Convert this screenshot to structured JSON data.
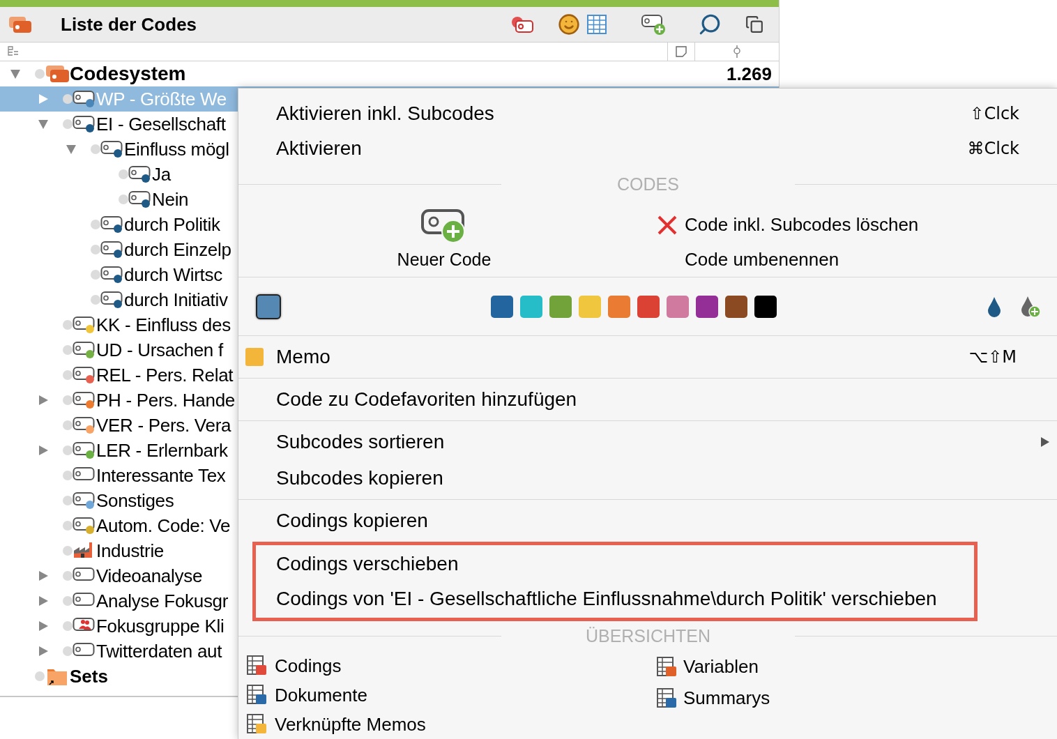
{
  "window": {
    "title": "Liste der Codes"
  },
  "tree": {
    "root": {
      "label": "Codesystem",
      "count": "1.269",
      "expanded": true
    },
    "items": [
      {
        "label": "WP - Größte We",
        "kind": "code",
        "color": "#4a86b8",
        "selected": true,
        "expanded": false
      },
      {
        "label": "EI - Gesellschaft",
        "kind": "code",
        "color": "#1f5a86",
        "selected": false,
        "expanded": true,
        "children": [
          {
            "label": "Einfluss mögl",
            "kind": "code",
            "color": "#1f5a86",
            "selected": false,
            "expanded": true,
            "children": [
              {
                "label": "Ja",
                "kind": "code",
                "color": "#1f5a86",
                "selected": false
              },
              {
                "label": "Nein",
                "kind": "code",
                "color": "#1f5a86",
                "selected": false
              }
            ]
          },
          {
            "label": "durch Politik",
            "kind": "code",
            "color": "#1f5a86",
            "selected": false
          },
          {
            "label": "durch Einzelp",
            "kind": "code",
            "color": "#1f5a86",
            "selected": false
          },
          {
            "label": "durch Wirtsc",
            "kind": "code",
            "color": "#1f5a86",
            "selected": false
          },
          {
            "label": "durch Initiativ",
            "kind": "code",
            "color": "#1f5a86",
            "selected": false
          }
        ]
      },
      {
        "label": "KK - Einfluss des",
        "kind": "code",
        "color": "#f0c53a",
        "selected": false
      },
      {
        "label": "UD - Ursachen f",
        "kind": "code",
        "color": "#74b043",
        "selected": false
      },
      {
        "label": "REL - Pers. Relat",
        "kind": "code",
        "color": "#e8604f",
        "selected": false
      },
      {
        "label": "PH - Pers. Hande",
        "kind": "code",
        "color": "#ec7a2f",
        "selected": false,
        "expanded": false
      },
      {
        "label": "VER - Pers. Vera",
        "kind": "code",
        "color": "#f8a466",
        "selected": false
      },
      {
        "label": "LER - Erlernbark",
        "kind": "code",
        "color": "#6ab043",
        "selected": false,
        "expanded": false
      },
      {
        "label": "Interessante Tex",
        "kind": "code-plain",
        "selected": false
      },
      {
        "label": "Sonstiges",
        "kind": "code",
        "color": "#6fa8d8",
        "selected": false
      },
      {
        "label": "Autom. Code: Ve",
        "kind": "code",
        "color": "#d8b030",
        "selected": false
      },
      {
        "label": "Industrie",
        "kind": "industry",
        "selected": false
      },
      {
        "label": "Videoanalyse",
        "kind": "code-plain",
        "selected": false,
        "expanded": false
      },
      {
        "label": "Analyse Fokusgr",
        "kind": "code-plain",
        "selected": false,
        "expanded": false
      },
      {
        "label": "Fokusgruppe Kli",
        "kind": "focus-group",
        "selected": false,
        "expanded": false
      },
      {
        "label": "Twitterdaten aut",
        "kind": "code-plain",
        "selected": false,
        "expanded": false
      }
    ],
    "sets": {
      "label": "Sets"
    }
  },
  "context_menu": {
    "activate_items": [
      {
        "label": "Aktivieren inkl. Subcodes",
        "shortcut": "⇧Clck"
      },
      {
        "label": "Aktivieren",
        "shortcut": "⌘Clck"
      }
    ],
    "codes_section": {
      "title": "CODES",
      "new_code": "Neuer Code",
      "actions": [
        {
          "label": "Code inkl. Subcodes löschen",
          "kind": "delete"
        },
        {
          "label": "Code umbenennen",
          "kind": "plain"
        }
      ]
    },
    "colors": {
      "current": {
        "color": "#5589b3"
      },
      "palette": [
        {
          "color": "#23659e"
        },
        {
          "color": "#26bdc8"
        },
        {
          "color": "#72a23a"
        },
        {
          "color": "#f0c63e"
        },
        {
          "color": "#ea7b32"
        },
        {
          "color": "#dc4234"
        },
        {
          "color": "#d07aa0"
        },
        {
          "color": "#952f98"
        },
        {
          "color": "#8b4a22"
        },
        {
          "color": "#000000"
        }
      ]
    },
    "groups": [
      [
        {
          "label": "Memo",
          "kind": "memo",
          "shortcut": "⌥⇧M"
        }
      ],
      [
        {
          "label": "Code zu Codefavoriten hinzufügen",
          "kind": "plain"
        }
      ],
      [
        {
          "label": "Subcodes sortieren",
          "kind": "plain",
          "submenu": true
        },
        {
          "label": "Subcodes kopieren",
          "kind": "plain"
        }
      ],
      [
        {
          "label": "Codings kopieren",
          "kind": "plain"
        }
      ]
    ],
    "highlighted": [
      {
        "label": "Codings verschieben"
      },
      {
        "label": "Codings von 'EI - Gesellschaftliche Einflussnahme\\durch Politik' verschieben"
      }
    ],
    "overviews": {
      "title": "ÜBERSICHTEN",
      "left": [
        {
          "label": "Codings",
          "kind": "codings"
        },
        {
          "label": "Dokumente",
          "kind": "documents"
        },
        {
          "label": "Verknüpfte Memos",
          "kind": "memos"
        }
      ],
      "right": [
        {
          "label": "Variablen",
          "kind": "variables"
        },
        {
          "label": "Summarys",
          "kind": "summaries"
        }
      ]
    }
  }
}
